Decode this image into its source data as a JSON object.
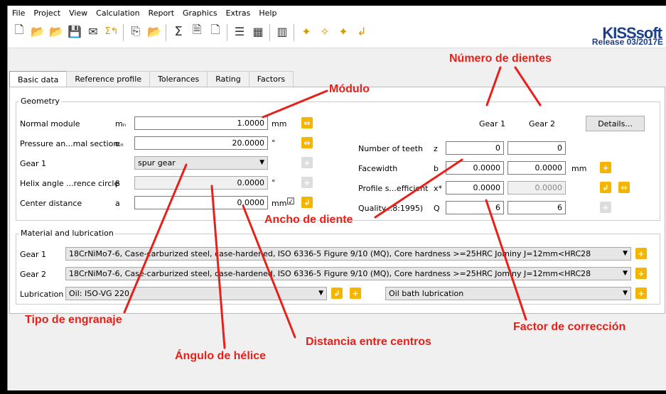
{
  "menu": [
    "File",
    "Project",
    "View",
    "Calculation",
    "Report",
    "Graphics",
    "Extras",
    "Help"
  ],
  "brand": {
    "logo": "KISSsoft",
    "release": "Release 03/2017E"
  },
  "tabs": [
    "Basic data",
    "Reference profile",
    "Tolerances",
    "Rating",
    "Factors"
  ],
  "geometry": {
    "title": "Geometry",
    "normal_module": {
      "label": "Normal module",
      "symbol": "mₙ",
      "value": "1.0000",
      "unit": "mm"
    },
    "pressure_angle": {
      "label": "Pressure an...mal section",
      "symbol": "αₙ",
      "value": "20.0000",
      "unit": "°"
    },
    "gear1_type": {
      "label": "Gear 1",
      "value": "spur gear"
    },
    "helix_angle": {
      "label": "Helix angle ...rence circle",
      "symbol": "β",
      "value": "0.0000",
      "unit": "°"
    },
    "center_distance": {
      "label": "Center distance",
      "symbol": "a",
      "value": "0.0000",
      "unit": "mm",
      "checked": "☑"
    }
  },
  "gear_table": {
    "col1": "Gear 1",
    "col2": "Gear 2",
    "details_button": "Details...",
    "teeth": {
      "label": "Number of teeth",
      "symbol": "z",
      "g1": "0",
      "g2": "0"
    },
    "facewidth": {
      "label": "Facewidth",
      "symbol": "b",
      "g1": "0.0000",
      "g2": "0.0000",
      "unit": "mm"
    },
    "profile_shift": {
      "label": "Profile s...efficient",
      "symbol": "x*",
      "g1": "0.0000",
      "g2": "0.0000"
    },
    "quality": {
      "label": "Quality...8:1995)",
      "symbol": "Q",
      "g1": "6",
      "g2": "6"
    }
  },
  "material": {
    "title": "Material and lubrication",
    "gear1_label": "Gear 1",
    "gear1_value": "18CrNiMo7-6, Case-carburized steel, case-hardened, ISO 6336-5 Figure 9/10 (MQ), Core hardness >=25HRC Jominy J=12mm<HRC28",
    "gear2_label": "Gear 2",
    "gear2_value": "18CrNiMo7-6, Case-carburized steel, case-hardened, ISO 6336-5 Figure 9/10 (MQ), Core hardness >=25HRC Jominy J=12mm<HRC28",
    "lub_label": "Lubrication",
    "lub_value": "Oil: ISO-VG 220",
    "lub_method": "Oil bath lubrication"
  },
  "annotations": {
    "modulo": "Módulo",
    "numero_dientes": "Número de dientes",
    "ancho_diente": "Ancho de diente",
    "tipo_engranaje": "Tipo de engranaje",
    "factor_correccion": "Factor de corrección",
    "distancia_centros": "Distancia entre centros",
    "angulo_helice": "Ángulo de hélice"
  },
  "colors": {
    "annotation": "#e8201a",
    "accent_button": "#f4b400",
    "brand": "#1b3f8c"
  }
}
